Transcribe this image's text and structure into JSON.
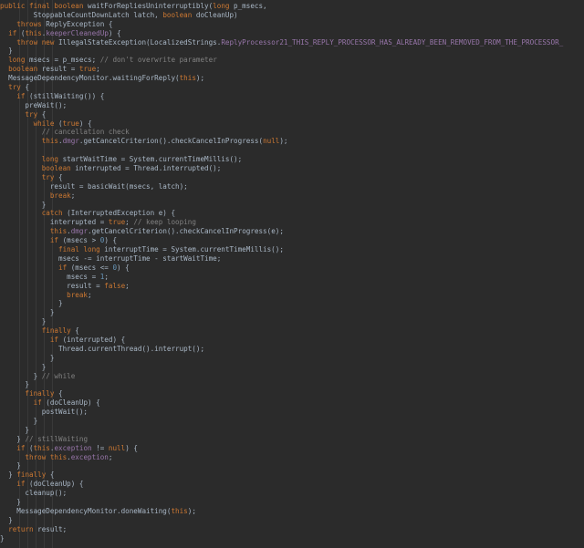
{
  "editor": {
    "colors": {
      "background": "#2b2b2b",
      "plain": "#a9b7c6",
      "keyword": "#cc7832",
      "comment": "#808080",
      "field": "#9876aa",
      "number": "#6897bb"
    },
    "lines": [
      [
        [
          "kw",
          "public final boolean "
        ],
        [
          "pl",
          "waitForRepliesUninterruptibly("
        ],
        [
          "kw",
          "long "
        ],
        [
          "pl",
          "p_msecs,"
        ]
      ],
      [
        [
          "pl",
          "        StoppableCountDownLatch latch, "
        ],
        [
          "kw",
          "boolean "
        ],
        [
          "pl",
          "doCleanUp)"
        ]
      ],
      [
        [
          "kw",
          "    throws "
        ],
        [
          "pl",
          "ReplyException {"
        ]
      ],
      [
        [
          "kw",
          "  if "
        ],
        [
          "pl",
          "("
        ],
        [
          "kw",
          "this"
        ],
        [
          "pl",
          "."
        ],
        [
          "fd",
          "keeperCleanedUp"
        ],
        [
          "pl",
          ") {"
        ]
      ],
      [
        [
          "kw",
          "    throw new "
        ],
        [
          "pl",
          "IllegalStateException(LocalizedStrings."
        ],
        [
          "fd",
          "ReplyProcessor21_THIS_REPLY_PROCESSOR_HAS_ALREADY_BEEN_REMOVED_FROM_THE_PROCESSOR_"
        ]
      ],
      [
        [
          "pl",
          "  }"
        ]
      ],
      [
        [
          "kw",
          "  long "
        ],
        [
          "pl",
          "msecs = p_msecs; "
        ],
        [
          "cm",
          "// don't overwrite parameter"
        ]
      ],
      [
        [
          "kw",
          "  boolean "
        ],
        [
          "pl",
          "result = "
        ],
        [
          "kw",
          "true"
        ],
        [
          "pl",
          ";"
        ]
      ],
      [
        [
          "pl",
          "  MessageDependencyMonitor."
        ],
        [
          "pl",
          "waitingForReply("
        ],
        [
          "kw",
          "this"
        ],
        [
          "pl",
          ");"
        ]
      ],
      [
        [
          "kw",
          "  try "
        ],
        [
          "pl",
          "{"
        ]
      ],
      [
        [
          "kw",
          "    if "
        ],
        [
          "pl",
          "(stillWaiting()) {"
        ]
      ],
      [
        [
          "pl",
          "      preWait();"
        ]
      ],
      [
        [
          "kw",
          "      try "
        ],
        [
          "pl",
          "{"
        ]
      ],
      [
        [
          "kw",
          "        while "
        ],
        [
          "pl",
          "("
        ],
        [
          "kw",
          "true"
        ],
        [
          "pl",
          ") {"
        ]
      ],
      [
        [
          "cm",
          "          // cancellation check"
        ]
      ],
      [
        [
          "kw",
          "          this"
        ],
        [
          "pl",
          "."
        ],
        [
          "fd",
          "dmgr"
        ],
        [
          "pl",
          ".getCancelCriterion().checkCancelInProgress("
        ],
        [
          "kw",
          "null"
        ],
        [
          "pl",
          ");"
        ]
      ],
      [
        [
          "pl",
          ""
        ]
      ],
      [
        [
          "kw",
          "          long "
        ],
        [
          "pl",
          "startWaitTime = System."
        ],
        [
          "pl",
          "currentTimeMillis();"
        ]
      ],
      [
        [
          "kw",
          "          boolean "
        ],
        [
          "pl",
          "interrupted = Thread."
        ],
        [
          "pl",
          "interrupted();"
        ]
      ],
      [
        [
          "kw",
          "          try "
        ],
        [
          "pl",
          "{"
        ]
      ],
      [
        [
          "pl",
          "            result = basicWait(msecs, latch);"
        ]
      ],
      [
        [
          "kw",
          "            break"
        ],
        [
          "pl",
          ";"
        ]
      ],
      [
        [
          "pl",
          "          }"
        ]
      ],
      [
        [
          "kw",
          "          catch "
        ],
        [
          "pl",
          "(InterruptedException e) {"
        ]
      ],
      [
        [
          "pl",
          "            interrupted = "
        ],
        [
          "kw",
          "true"
        ],
        [
          "pl",
          "; "
        ],
        [
          "cm",
          "// keep looping"
        ]
      ],
      [
        [
          "kw",
          "            this"
        ],
        [
          "pl",
          "."
        ],
        [
          "fd",
          "dmgr"
        ],
        [
          "pl",
          ".getCancelCriterion().checkCancelInProgress(e);"
        ]
      ],
      [
        [
          "kw",
          "            if "
        ],
        [
          "pl",
          "(msecs > "
        ],
        [
          "nm",
          "0"
        ],
        [
          "pl",
          ") {"
        ]
      ],
      [
        [
          "kw",
          "              final long "
        ],
        [
          "pl",
          "interruptTime = System."
        ],
        [
          "pl",
          "currentTimeMillis();"
        ]
      ],
      [
        [
          "pl",
          "              msecs -= interruptTime - startWaitTime;"
        ]
      ],
      [
        [
          "kw",
          "              if "
        ],
        [
          "pl",
          "(msecs <= "
        ],
        [
          "nm",
          "0"
        ],
        [
          "pl",
          ") {"
        ]
      ],
      [
        [
          "pl",
          "                msecs = "
        ],
        [
          "nm",
          "1"
        ],
        [
          "pl",
          ";"
        ]
      ],
      [
        [
          "pl",
          "                result = "
        ],
        [
          "kw",
          "false"
        ],
        [
          "pl",
          ";"
        ]
      ],
      [
        [
          "kw",
          "                break"
        ],
        [
          "pl",
          ";"
        ]
      ],
      [
        [
          "pl",
          "              }"
        ]
      ],
      [
        [
          "pl",
          "            }"
        ]
      ],
      [
        [
          "pl",
          "          }"
        ]
      ],
      [
        [
          "kw",
          "          finally "
        ],
        [
          "pl",
          "{"
        ]
      ],
      [
        [
          "kw",
          "            if "
        ],
        [
          "pl",
          "(interrupted) {"
        ]
      ],
      [
        [
          "pl",
          "              Thread."
        ],
        [
          "pl",
          "currentThread().interrupt();"
        ]
      ],
      [
        [
          "pl",
          "            }"
        ]
      ],
      [
        [
          "pl",
          "          }"
        ]
      ],
      [
        [
          "pl",
          "        } "
        ],
        [
          "cm",
          "// while"
        ]
      ],
      [
        [
          "pl",
          "      }"
        ]
      ],
      [
        [
          "kw",
          "      finally "
        ],
        [
          "pl",
          "{"
        ]
      ],
      [
        [
          "kw",
          "        if "
        ],
        [
          "pl",
          "(doCleanUp) {"
        ]
      ],
      [
        [
          "pl",
          "          postWait();"
        ]
      ],
      [
        [
          "pl",
          "        }"
        ]
      ],
      [
        [
          "pl",
          "      }"
        ]
      ],
      [
        [
          "pl",
          "    } "
        ],
        [
          "cm",
          "// stillWaiting"
        ]
      ],
      [
        [
          "kw",
          "    if "
        ],
        [
          "pl",
          "("
        ],
        [
          "kw",
          "this"
        ],
        [
          "pl",
          "."
        ],
        [
          "fd",
          "exception "
        ],
        [
          "pl",
          "!= "
        ],
        [
          "kw",
          "null"
        ],
        [
          "pl",
          ") {"
        ]
      ],
      [
        [
          "kw",
          "      throw this"
        ],
        [
          "pl",
          "."
        ],
        [
          "fd",
          "exception"
        ],
        [
          "pl",
          ";"
        ]
      ],
      [
        [
          "pl",
          "    }"
        ]
      ],
      [
        [
          "pl",
          "  } "
        ],
        [
          "kw",
          "finally "
        ],
        [
          "pl",
          "{"
        ]
      ],
      [
        [
          "kw",
          "    if "
        ],
        [
          "pl",
          "(doCleanUp) {"
        ]
      ],
      [
        [
          "pl",
          "      cleanup();"
        ]
      ],
      [
        [
          "pl",
          "    }"
        ]
      ],
      [
        [
          "pl",
          "    MessageDependencyMonitor."
        ],
        [
          "pl",
          "doneWaiting("
        ],
        [
          "kw",
          "this"
        ],
        [
          "pl",
          ");"
        ]
      ],
      [
        [
          "pl",
          "  }"
        ]
      ],
      [
        [
          "kw",
          "  return "
        ],
        [
          "pl",
          "result;"
        ]
      ],
      [
        [
          "pl",
          "}"
        ]
      ]
    ]
  }
}
